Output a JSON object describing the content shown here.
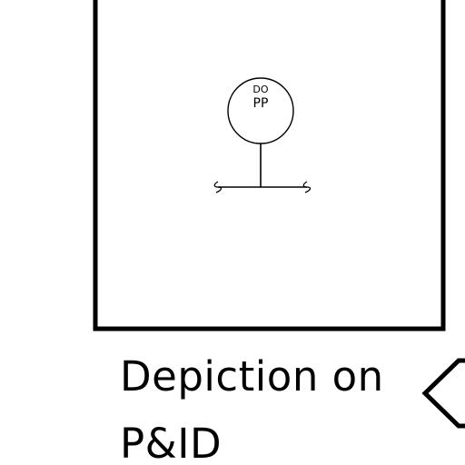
{
  "diagram": {
    "instrument_bubble": {
      "top_text": "DO",
      "bottom_text": "PP"
    }
  },
  "caption": {
    "line1": "Depiction on",
    "line2": "P&ID"
  },
  "colors": {
    "stroke": "#000000",
    "background": "#ffffff"
  },
  "icons": {
    "arrow": "left-arrow-outline-icon"
  }
}
